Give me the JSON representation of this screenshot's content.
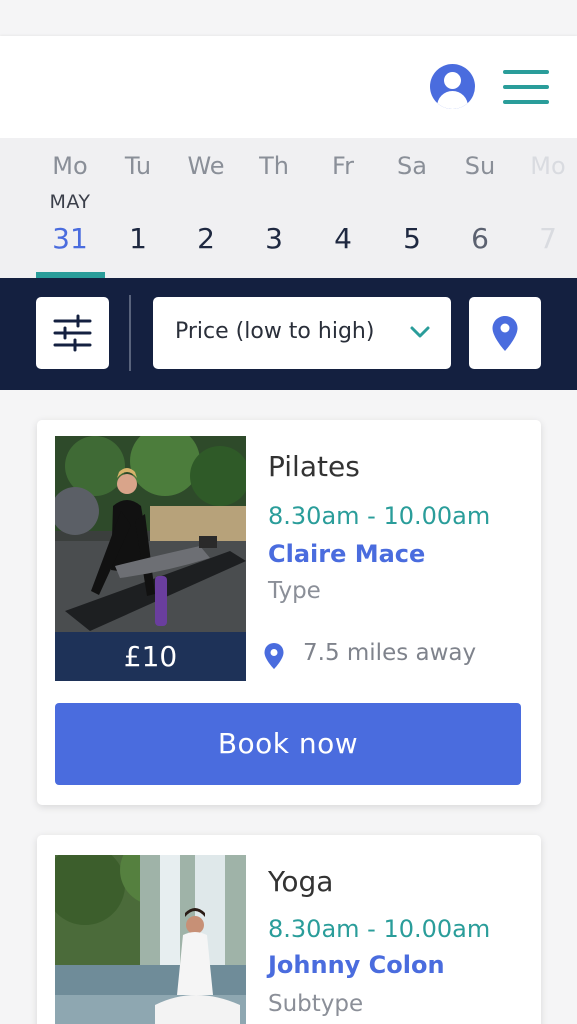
{
  "calendar": {
    "month": "MAY",
    "days": [
      {
        "name": "Mo",
        "num": "31"
      },
      {
        "name": "Tu",
        "num": "1"
      },
      {
        "name": "We",
        "num": "2"
      },
      {
        "name": "Th",
        "num": "3"
      },
      {
        "name": "Fr",
        "num": "4"
      },
      {
        "name": "Sa",
        "num": "5"
      },
      {
        "name": "Su",
        "num": "6"
      },
      {
        "name": "Mo",
        "num": "7"
      }
    ]
  },
  "filters": {
    "sort_label": "Price (low to high)"
  },
  "classes": [
    {
      "title": "Pilates",
      "time": "8.30am - 10.00am",
      "instructor": "Claire Mace",
      "type": "Type",
      "price": "£10",
      "distance": "7.5 miles away",
      "book_label": "Book now"
    },
    {
      "title": "Yoga",
      "time": "8.30am - 10.00am",
      "instructor": "Johnny Colon",
      "type": "Subtype"
    }
  ],
  "colors": {
    "accent_blue": "#4a6cde",
    "teal": "#2a9d9a",
    "navy": "#142040"
  }
}
